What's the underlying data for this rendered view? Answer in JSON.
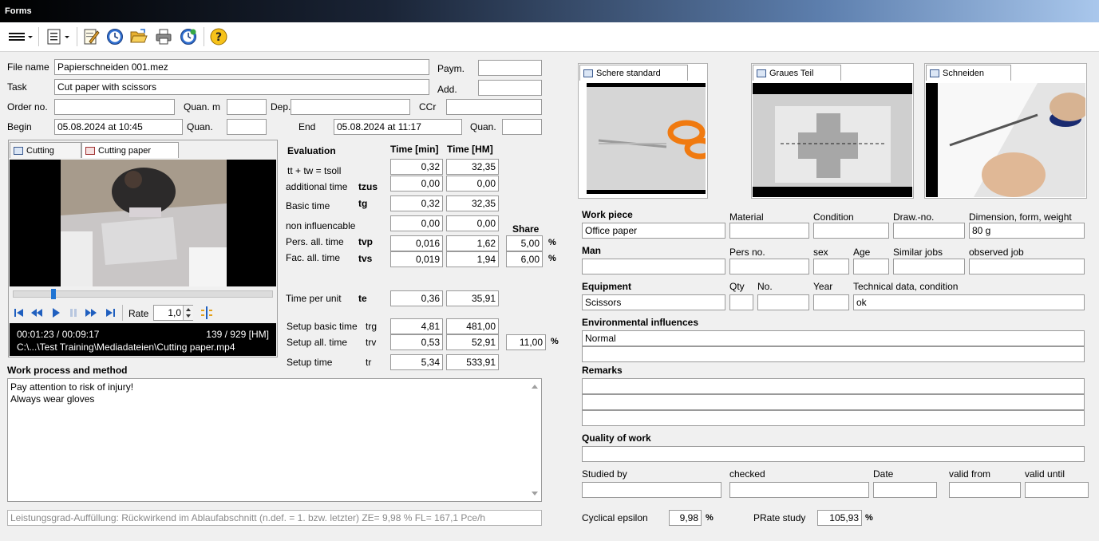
{
  "window": {
    "title": "Forms"
  },
  "header": {
    "file_name_label": "File name",
    "file_name": "Papierschneiden 001.mez",
    "task_label": "Task",
    "task": "Cut paper with scissors",
    "order_label": "Order no.",
    "order": "",
    "quan_m_label": "Quan. m",
    "quan_m": "",
    "dep_label": "Dep.",
    "dep": "",
    "ccr_label": "CCr",
    "ccr": "",
    "paym_label": "Paym.",
    "paym": "",
    "add_label": "Add.",
    "add": "",
    "begin_label": "Begin",
    "begin": "05.08.2024  at 10:45",
    "quan1_label": "Quan.",
    "quan1": "",
    "end_label": "End",
    "end": "05.08.2024  at 11:17",
    "quan2_label": "Quan.",
    "quan2": ""
  },
  "video": {
    "tabs": [
      {
        "label": "Cutting"
      },
      {
        "label": "Cutting paper"
      }
    ],
    "rate_label": "Rate",
    "rate_value": "1,0",
    "progress": 0.147,
    "time_readout": "00:01:23 / 00:09:17",
    "frame_readout": "139 / 929 [HM]",
    "path": "C:\\...\\Test Training\\Mediadateien\\Cutting paper.mp4"
  },
  "evaluation": {
    "title": "Evaluation",
    "col_min": "Time [min]",
    "col_hm": "Time [HM]",
    "share_label": "Share",
    "rows": [
      {
        "label": "tt + tw = tsoll",
        "code": "",
        "min": "0,32",
        "hm": "32,35",
        "share": ""
      },
      {
        "label": "additional time",
        "code": "tzus",
        "min": "0,00",
        "hm": "0,00",
        "share": ""
      },
      {
        "label": "Basic time",
        "code": "tg",
        "min": "0,32",
        "hm": "32,35",
        "share": ""
      },
      {
        "label": "non influencable",
        "code": "",
        "min": "0,00",
        "hm": "0,00",
        "share": ""
      },
      {
        "label": "Pers. all. time",
        "code": "tvp",
        "min": "0,016",
        "hm": "1,62",
        "share": "5,00"
      },
      {
        "label": "Fac. all. time",
        "code": "tvs",
        "min": "0,019",
        "hm": "1,94",
        "share": "6,00"
      },
      {
        "label": "Time per unit",
        "code": "te",
        "min": "0,36",
        "hm": "35,91",
        "share": ""
      },
      {
        "label": "Setup basic time",
        "code": "trg",
        "min": "4,81",
        "hm": "481,00",
        "share": ""
      },
      {
        "label": "Setup all. time",
        "code": "trv",
        "min": "0,53",
        "hm": "52,91",
        "share": "11,00"
      },
      {
        "label": "Setup time",
        "code": "tr",
        "min": "5,34",
        "hm": "533,91",
        "share": ""
      }
    ],
    "pct_symbol": "%"
  },
  "work_process": {
    "title": "Work process and method",
    "lines": [
      "Pay attention to risk of injury!",
      "Always wear gloves"
    ]
  },
  "status_line": "Leistungsgrad-Auffüllung: Rückwirkend im Ablaufabschnitt (n.def. = 1. bzw. letzter)  ZE=  9,98 %  FL=  167,1 Pce/h",
  "images": [
    {
      "tab": "Schere standard"
    },
    {
      "tab": "Graues Teil"
    },
    {
      "tab": "Schneiden"
    }
  ],
  "workpiece": {
    "title": "Work piece",
    "value": "Office paper",
    "material_label": "Material",
    "material": "",
    "condition_label": "Condition",
    "condition": "",
    "drawno_label": "Draw.-no.",
    "drawno": "",
    "dimension_label": "Dimension, form, weight",
    "dimension": "80 g"
  },
  "man": {
    "title": "Man",
    "value": "",
    "persno_label": "Pers no.",
    "persno": "",
    "sex_label": "sex",
    "sex": "",
    "age_label": "Age",
    "age": "",
    "similar_label": "Similar jobs",
    "similar": "",
    "observed_label": "observed job",
    "observed": ""
  },
  "equipment": {
    "title": "Equipment",
    "value": "Scissors",
    "qty_label": "Qty",
    "qty": "",
    "no_label": "No.",
    "no": "",
    "year_label": "Year",
    "year": "",
    "tech_label": "Technical data, condition",
    "tech": "ok"
  },
  "environment": {
    "title": "Environmental influences",
    "line1": "Normal",
    "line2": ""
  },
  "remarks": {
    "title": "Remarks"
  },
  "quality": {
    "title": "Quality of work"
  },
  "study": {
    "studied_label": "Studied by",
    "checked_label": "checked",
    "date_label": "Date",
    "valid_from_label": "valid from",
    "valid_until_label": "valid until"
  },
  "footer": {
    "epsilon_label": "Cyclical epsilon",
    "epsilon": "9,98",
    "prate_label": "PRate study",
    "prate": "105,93",
    "pct": "%"
  }
}
